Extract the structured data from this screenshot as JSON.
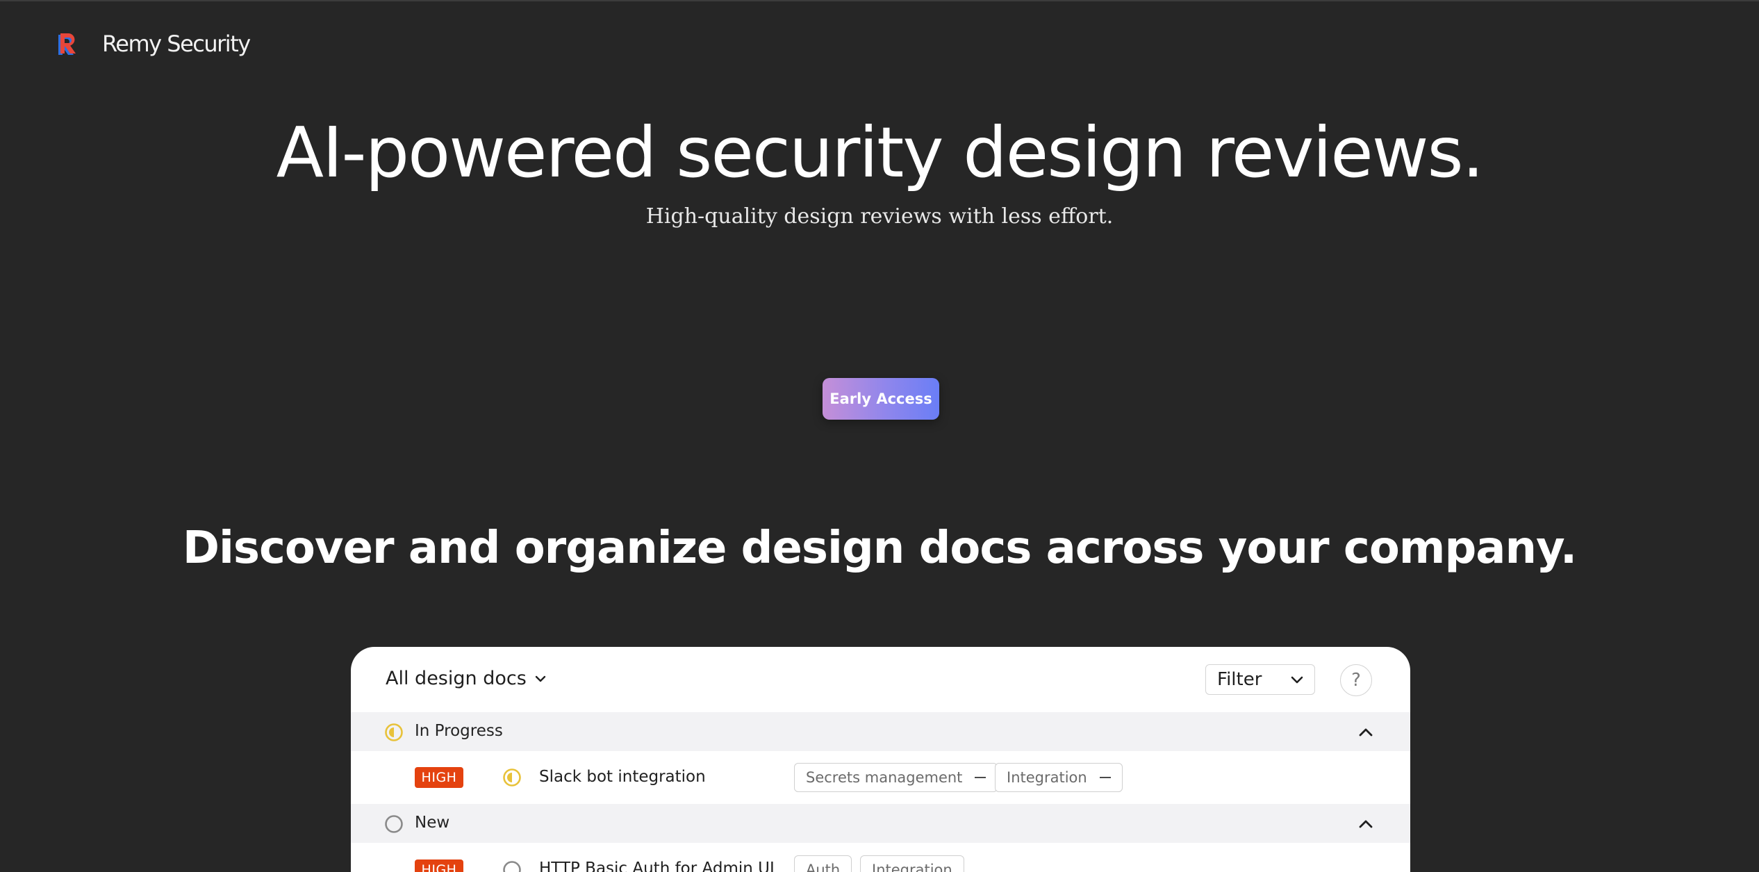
{
  "header": {
    "brand": "Remy Security",
    "logo_letter": "R"
  },
  "hero": {
    "title": "AI-powered security design reviews.",
    "subtitle": "High-quality design reviews with less effort.",
    "cta_label": "Early Access"
  },
  "section": {
    "title": "Discover and organize design docs across your company."
  },
  "panel": {
    "doc_selector": "All design docs",
    "filter_label": "Filter",
    "help_label": "?",
    "groups": [
      {
        "label": "In Progress",
        "icon": "half-circle-yellow-icon",
        "items": [
          {
            "severity": "HIGH",
            "title": "Slack bot integration",
            "tags": [
              "Secrets management",
              "Integration"
            ]
          }
        ]
      },
      {
        "label": "New",
        "icon": "empty-circle-icon",
        "items": [
          {
            "severity": "HIGH",
            "title": "HTTP Basic Auth for Admin UI",
            "tags": [
              "Auth",
              "Integration"
            ]
          }
        ]
      }
    ]
  },
  "colors": {
    "background": "#262626",
    "high_badge": "#e4420f",
    "in_progress": "#e8c23a",
    "cta_gradient_start": "#c58fd8",
    "cta_gradient_end": "#6a7ef6"
  }
}
